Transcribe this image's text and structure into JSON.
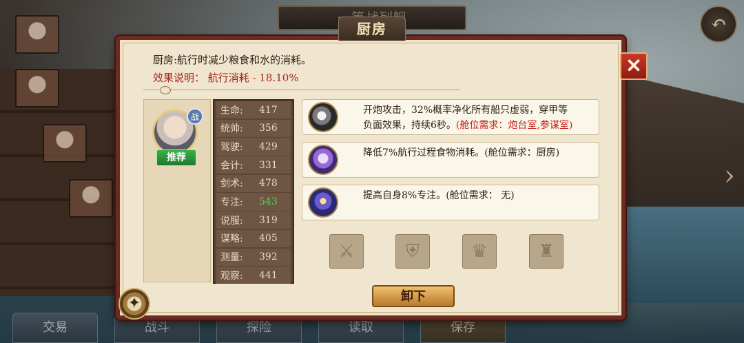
{
  "scene": {
    "banner_title": "一等战列舰",
    "back_icon": "back-arrow-icon",
    "next_icon": "chevron-right-icon"
  },
  "bottom_bar": [
    "交易",
    "战斗",
    "探险",
    "读取",
    "保存"
  ],
  "dialog": {
    "title": "厨房",
    "close_label": "✕",
    "description": "厨房:航行时减少粮食和水的消耗。",
    "effect": "效果说明： 航行消耗 - 18.10%",
    "recommend_label": "推荐",
    "battle_badge": "战",
    "stats": [
      {
        "label": "生命:",
        "value": "417",
        "highlight": false
      },
      {
        "label": "统帅:",
        "value": "356",
        "highlight": false
      },
      {
        "label": "驾驶:",
        "value": "429",
        "highlight": false
      },
      {
        "label": "会计:",
        "value": "331",
        "highlight": false
      },
      {
        "label": "剑术:",
        "value": "478",
        "highlight": false
      },
      {
        "label": "专注:",
        "value": "543",
        "highlight": true
      },
      {
        "label": "说服:",
        "value": "319",
        "highlight": false
      },
      {
        "label": "谋略:",
        "value": "405",
        "highlight": false
      },
      {
        "label": "测量:",
        "value": "392",
        "highlight": false
      },
      {
        "label": "观察:",
        "value": "441",
        "highlight": false
      }
    ],
    "skills": [
      {
        "icon": "cannon-icon",
        "line1": "开炮攻击，32%概率净化所有船只虚弱，穿甲等",
        "line2_text": "负面效果，持续6秒。",
        "line2_req": "(舱位需求：炮台室,参谋室)"
      },
      {
        "icon": "food-icon",
        "line1": "降低7%航行过程食物消耗。(舱位需求：厨房)"
      },
      {
        "icon": "focus-icon",
        "line1": "提高自身8%专注。(舱位需求： 无)"
      }
    ],
    "equipment_slots": [
      "sword-slot-icon",
      "armor-slot-icon",
      "trophy-slot-icon",
      "cup-slot-icon"
    ],
    "unload_label": "卸下"
  }
}
